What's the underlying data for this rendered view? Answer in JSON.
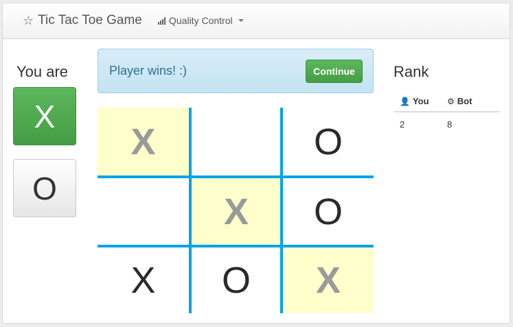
{
  "navbar": {
    "brand_icon": "star-icon",
    "brand_title": "Tic Tac Toe Game",
    "dropdown_icon": "signal-bars-icon",
    "dropdown_label": "Quality Control"
  },
  "player": {
    "heading": "You are",
    "options": [
      "X",
      "O"
    ],
    "selected": "X"
  },
  "alert": {
    "message": "Player wins! :)",
    "button_label": "Continue"
  },
  "board": {
    "cells": [
      {
        "value": "X",
        "win": true
      },
      {
        "value": "",
        "win": false
      },
      {
        "value": "O",
        "win": false
      },
      {
        "value": "",
        "win": false
      },
      {
        "value": "X",
        "win": true
      },
      {
        "value": "O",
        "win": false
      },
      {
        "value": "X",
        "win": false
      },
      {
        "value": "O",
        "win": false
      },
      {
        "value": "X",
        "win": true
      }
    ],
    "colors": {
      "grid": "#00a4e4",
      "win_bg": "#ffffcc",
      "win_text": "#9a9a9a"
    }
  },
  "rank": {
    "title": "Rank",
    "headers": [
      {
        "icon": "user-icon",
        "label": "You"
      },
      {
        "icon": "gear-icon",
        "label": "Bot"
      }
    ],
    "scores": [
      "2",
      "8"
    ]
  }
}
